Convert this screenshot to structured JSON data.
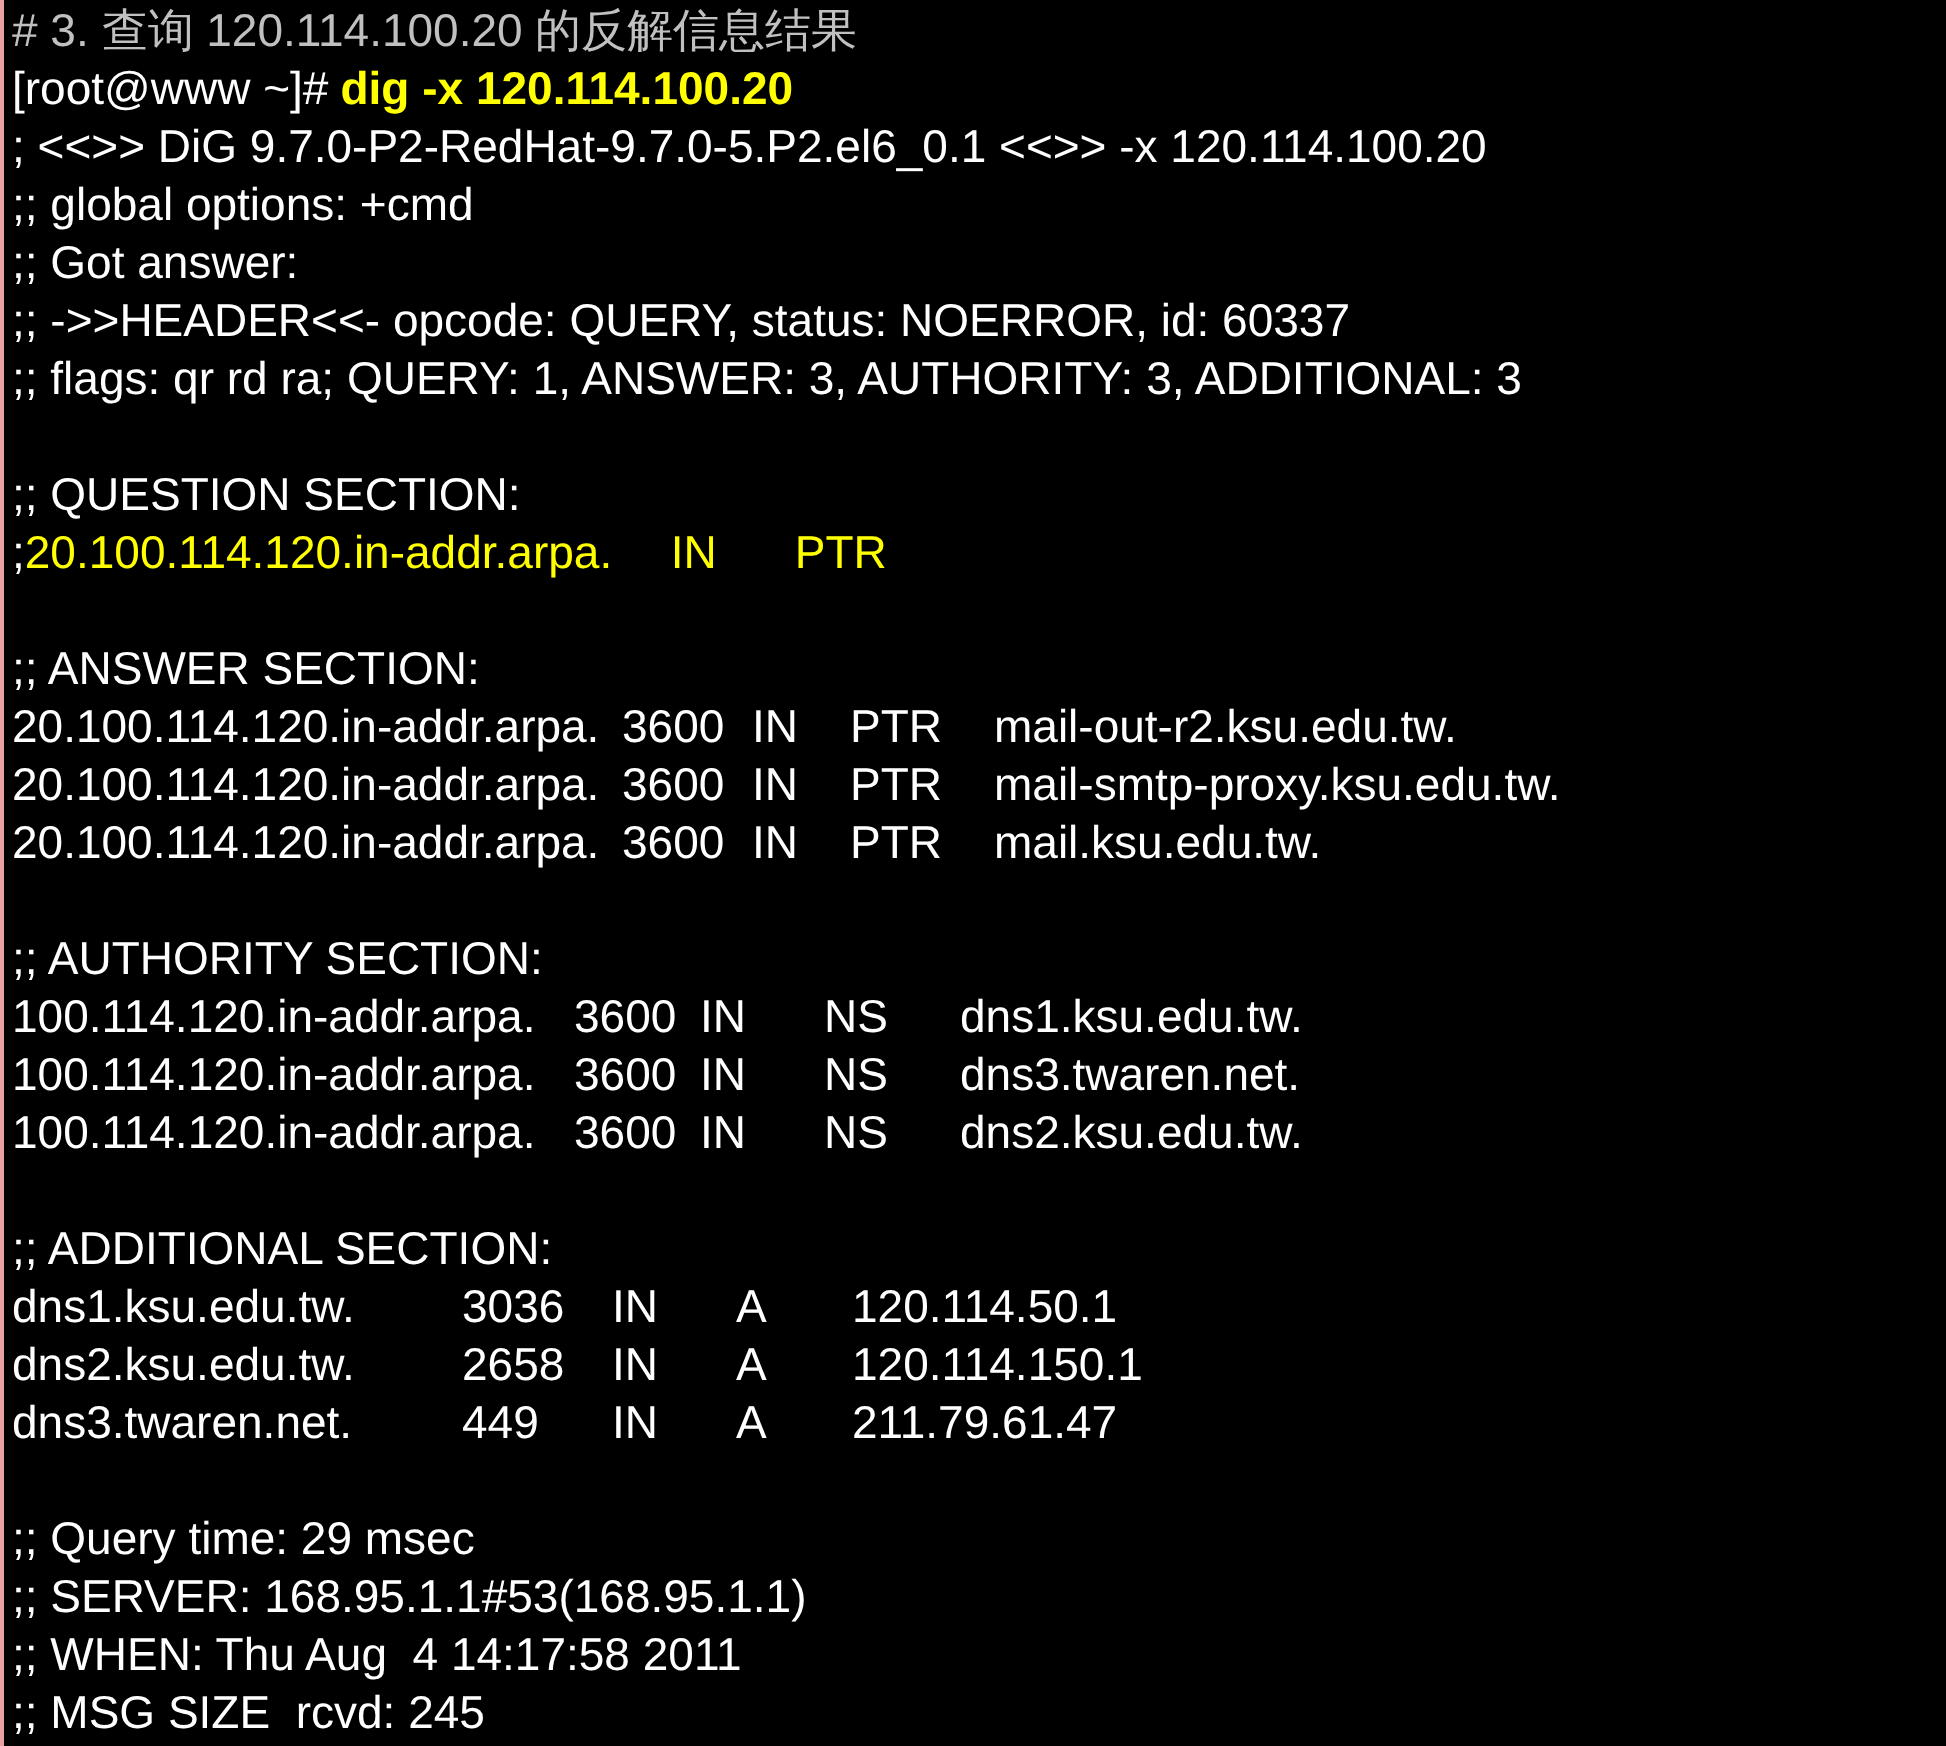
{
  "terminal": {
    "lines": [
      {
        "kind": "comment",
        "text": "# 3. 查询 120.114.100.20 的反解信息结果"
      },
      {
        "kind": "prompt",
        "prompt": "[root@www ~]#",
        "command": "dig -x 120.114.100.20"
      },
      {
        "kind": "text",
        "text": "; <<>> DiG 9.7.0-P2-RedHat-9.7.0-5.P2.el6_0.1 <<>> -x 120.114.100.20"
      },
      {
        "kind": "text",
        "text": ";; global options: +cmd"
      },
      {
        "kind": "text",
        "text": ";; Got answer:"
      },
      {
        "kind": "text",
        "text": ";; ->>HEADER<<- opcode: QUERY, status: NOERROR, id: 60337"
      },
      {
        "kind": "text",
        "text": ";; flags: qr rd ra; QUERY: 1, ANSWER: 3, AUTHORITY: 3, ADDITIONAL: 3"
      },
      {
        "kind": "blank"
      },
      {
        "kind": "text",
        "text": ";; QUESTION SECTION:"
      },
      {
        "kind": "question",
        "prefix": ";",
        "fields": [
          "20.100.114.120.in-addr.arpa.",
          "IN",
          "PTR"
        ]
      },
      {
        "kind": "blank"
      },
      {
        "kind": "text",
        "text": ";; ANSWER SECTION:"
      },
      {
        "kind": "answer",
        "fields": [
          "20.100.114.120.in-addr.arpa.",
          "3600",
          "IN",
          "PTR",
          "mail-out-r2.ksu.edu.tw."
        ]
      },
      {
        "kind": "answer",
        "fields": [
          "20.100.114.120.in-addr.arpa.",
          "3600",
          "IN",
          "PTR",
          "mail-smtp-proxy.ksu.edu.tw."
        ]
      },
      {
        "kind": "answer",
        "fields": [
          "20.100.114.120.in-addr.arpa.",
          "3600",
          "IN",
          "PTR",
          "mail.ksu.edu.tw."
        ]
      },
      {
        "kind": "blank"
      },
      {
        "kind": "text",
        "text": ";; AUTHORITY SECTION:"
      },
      {
        "kind": "authority",
        "fields": [
          "100.114.120.in-addr.arpa.",
          "3600",
          "IN",
          "NS",
          "dns1.ksu.edu.tw."
        ]
      },
      {
        "kind": "authority",
        "fields": [
          "100.114.120.in-addr.arpa.",
          "3600",
          "IN",
          "NS",
          "dns3.twaren.net."
        ]
      },
      {
        "kind": "authority",
        "fields": [
          "100.114.120.in-addr.arpa.",
          "3600",
          "IN",
          "NS",
          "dns2.ksu.edu.tw."
        ]
      },
      {
        "kind": "blank"
      },
      {
        "kind": "text",
        "text": ";; ADDITIONAL SECTION:"
      },
      {
        "kind": "additional",
        "fields": [
          "dns1.ksu.edu.tw.",
          "3036",
          "IN",
          "A",
          "120.114.50.1"
        ]
      },
      {
        "kind": "additional",
        "fields": [
          "dns2.ksu.edu.tw.",
          "2658",
          "IN",
          "A",
          "120.114.150.1"
        ]
      },
      {
        "kind": "additional",
        "fields": [
          "dns3.twaren.net.",
          "449",
          "IN",
          "A",
          "211.79.61.47"
        ]
      },
      {
        "kind": "blank"
      },
      {
        "kind": "text",
        "text": ";; Query time: 29 msec"
      },
      {
        "kind": "text",
        "text": ";; SERVER: 168.95.1.1#53(168.95.1.1)"
      },
      {
        "kind": "text",
        "text": ";; WHEN: Thu Aug  4 14:17:58 2011"
      },
      {
        "kind": "text",
        "text": ";; MSG SIZE  rcvd: 245"
      }
    ]
  }
}
